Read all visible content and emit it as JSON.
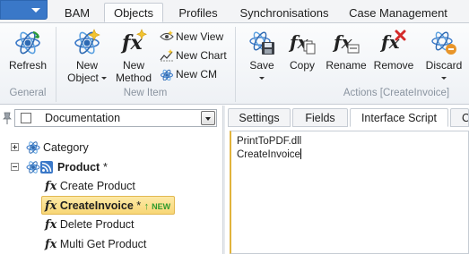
{
  "tabs": [
    "BAM",
    "Objects",
    "Profiles",
    "Synchronisations",
    "Case Management"
  ],
  "ribbon": {
    "general": {
      "label": "General",
      "refresh": "Refresh"
    },
    "new_item": {
      "label": "New Item",
      "new_object_line1": "New",
      "new_object_line2": "Object",
      "new_method_line1": "New",
      "new_method_line2": "Method",
      "new_view": "New View",
      "new_chart": "New Chart",
      "new_cm": "New CM"
    },
    "actions": {
      "label": "Actions [CreateInvoice]",
      "save": "Save",
      "copy": "Copy",
      "rename": "Rename",
      "remove": "Remove",
      "discard": "Discard"
    }
  },
  "filter": {
    "selected": "Documentation"
  },
  "tree": {
    "category": "Category",
    "product": "Product",
    "product_marker": "*",
    "children": [
      "Create Product",
      "CreateInvoice",
      "Delete Product",
      "Multi Get Product"
    ],
    "selected_marker": "*",
    "new_badge": "NEW"
  },
  "right_tabs": [
    "Settings",
    "Fields",
    "Interface Script",
    "C"
  ],
  "editor": {
    "line1": "PrintToPDF.dll",
    "line2": "CreateInvoice"
  },
  "colors": {
    "accent": "#3a78c8",
    "selection": "#f8d776",
    "new_badge": "#2f9a2f"
  }
}
